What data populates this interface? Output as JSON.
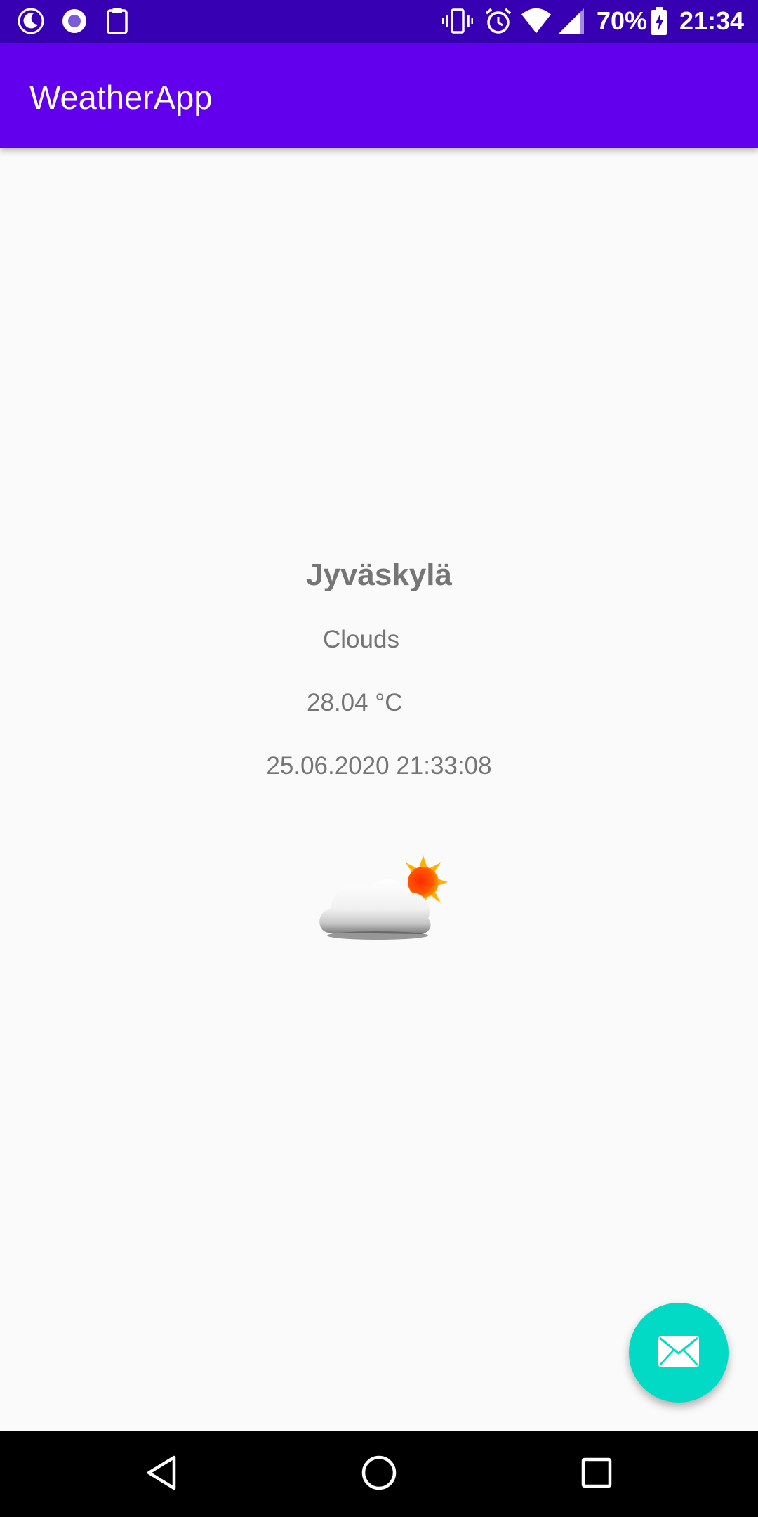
{
  "status_bar": {
    "battery_percent": "70%",
    "time": "21:34",
    "icons": [
      "moon-icon",
      "record-icon",
      "clipboard-icon",
      "vibrate-icon",
      "alarm-icon",
      "wifi-icon",
      "cell-signal-icon",
      "battery-charging-icon"
    ]
  },
  "app_bar": {
    "title": "WeatherApp"
  },
  "weather": {
    "city": "Jyväskylä",
    "condition": "Clouds",
    "temperature": "28.04 °C",
    "updated": "25.06.2020 21:33:08",
    "icon": "partly-cloudy-icon"
  },
  "fab": {
    "icon": "email-icon"
  },
  "nav_bar": {
    "buttons": [
      "back-icon",
      "home-icon",
      "recents-icon"
    ]
  },
  "colors": {
    "status_bar": "#3700b3",
    "app_bar": "#6200ee",
    "fab": "#03dac5",
    "text_secondary": "#757575",
    "background": "#fafafa"
  }
}
